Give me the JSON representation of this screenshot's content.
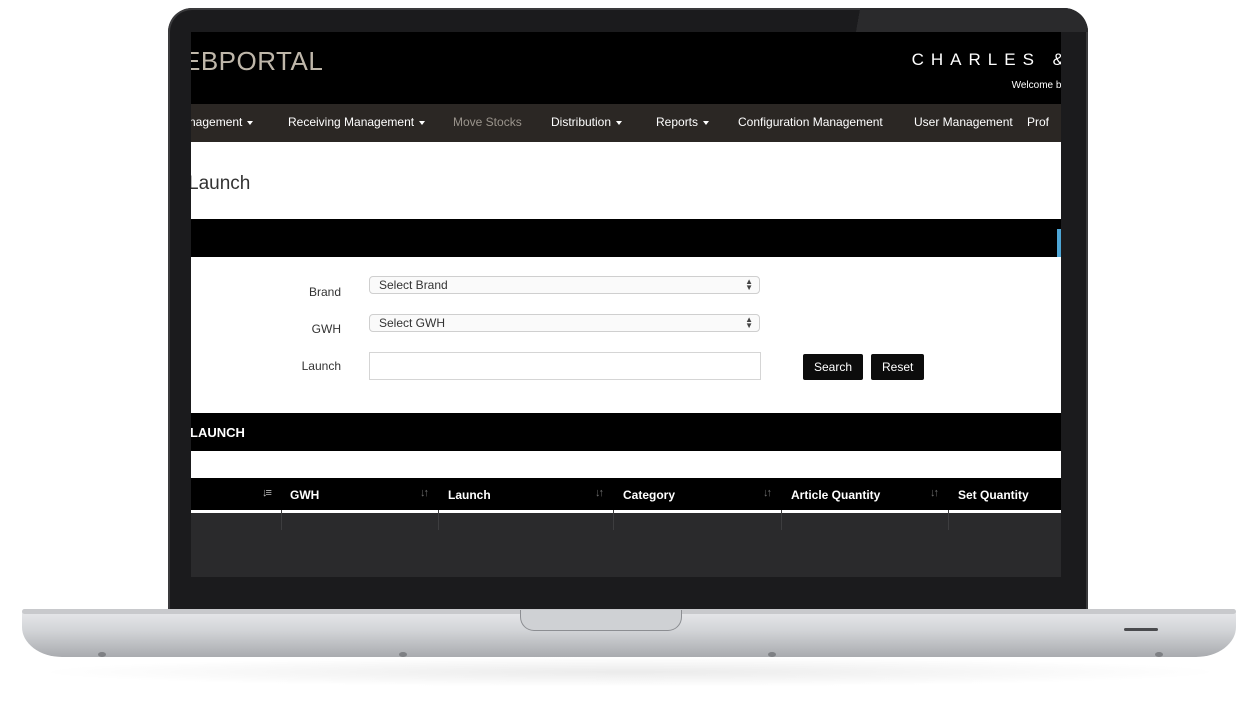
{
  "header": {
    "portal_title": "EBPORTAL",
    "company": "CHARLES &",
    "welcome": "Welcome ba"
  },
  "nav": {
    "items": [
      {
        "label": "nagement",
        "dropdown": true
      },
      {
        "label": "Receiving Management",
        "dropdown": true
      },
      {
        "label": "Move Stocks",
        "dropdown": false,
        "disabled": true
      },
      {
        "label": "Distribution",
        "dropdown": true
      },
      {
        "label": "Reports",
        "dropdown": true
      },
      {
        "label": "Configuration Management",
        "dropdown": false
      },
      {
        "label": "User Management",
        "dropdown": false
      },
      {
        "label": "Prof",
        "dropdown": false
      }
    ]
  },
  "page": {
    "title": "Launch"
  },
  "form": {
    "brand_label": "Brand",
    "brand_value": "Select Brand",
    "gwh_label": "GWH",
    "gwh_value": "Select GWH",
    "launch_label": "Launch",
    "launch_value": "",
    "search_label": "Search",
    "reset_label": "Reset"
  },
  "results": {
    "section_title": "LAUNCH",
    "columns": [
      "GWH",
      "Launch",
      "Category",
      "Article Quantity",
      "Set Quantity"
    ]
  },
  "colors": {
    "brand_bar": "#000000",
    "nav_bar": "#2b2724",
    "accent_blue": "#4ea6d6",
    "button": "#0c0c0c"
  },
  "icons": {
    "sort_active": "sort-amount-down-icon",
    "sort": "sort-icon",
    "select_arrows": "updown-arrows-icon",
    "caret": "caret-down-icon"
  }
}
